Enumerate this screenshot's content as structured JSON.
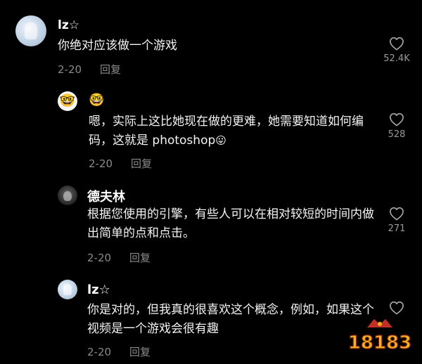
{
  "comments": [
    {
      "username": "lz☆",
      "text": "你绝对应该做一个游戏",
      "date": "2-20",
      "reply_label": "回复",
      "likes": "52.4K"
    },
    {
      "username": "🤓",
      "text": "嗯，实际上这比她现在做的更难，她需要知道如何编码，这就是 photoshop",
      "text_emoji": "😛",
      "date": "2-20",
      "reply_label": "回复",
      "likes": "528"
    },
    {
      "username": "德夫林",
      "text": "根据您使用的引擎，有些人可以在相对较短的时间内做出简单的点和点击。",
      "date": "2-20",
      "reply_label": "回复",
      "likes": "271"
    },
    {
      "username": "lz☆",
      "text": "你是对的，但我真的很喜欢这个概念，例如，如果这个视频是一个游戏会很有趣",
      "date": "2-20",
      "reply_label": "回复",
      "likes": ""
    }
  ],
  "watermark": {
    "text": "18183"
  },
  "colors": {
    "background": "#000000",
    "text": "#f4f4f4",
    "muted": "#8a8a8a",
    "watermark_gold": "#f2b21d",
    "watermark_red": "#d7342b"
  }
}
